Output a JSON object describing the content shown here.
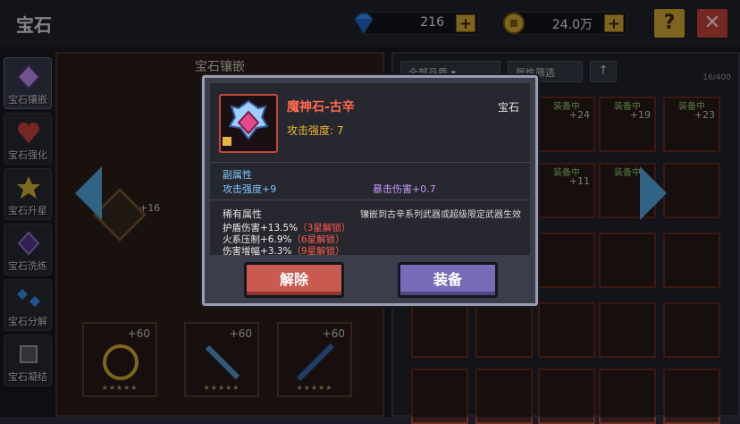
{
  "page": {
    "title": "宝石"
  },
  "currency": {
    "diamond": {
      "value": "216"
    },
    "gold": {
      "value": "24.0万"
    }
  },
  "top_buttons": {
    "help": "?",
    "close": "✕"
  },
  "sidebar": {
    "items": [
      {
        "label": "宝石镶嵌",
        "icon": "gem-inlay-icon"
      },
      {
        "label": "宝石强化",
        "icon": "gem-enhance-icon"
      },
      {
        "label": "宝石升星",
        "icon": "gem-star-icon"
      },
      {
        "label": "宝石洗练",
        "icon": "gem-refine-icon"
      },
      {
        "label": "宝石分解",
        "icon": "gem-decompose-icon"
      },
      {
        "label": "宝石凝结",
        "icon": "gem-condense-icon"
      }
    ]
  },
  "left_panel": {
    "title": "宝石镶嵌",
    "side_level": "+16",
    "bottom_slots": [
      {
        "level": "+60",
        "stars": "★★★★★"
      },
      {
        "level": "+60",
        "stars": "★★★★★"
      },
      {
        "level": "+60",
        "stars": "★★★★★"
      }
    ]
  },
  "right_panel": {
    "filter_quality": "全部品质",
    "filter_attr": "属性筛选",
    "count": "16/400",
    "equipped_tag": "装备中",
    "slot_levels": [
      "+24",
      "+19",
      "+23",
      "+11"
    ]
  },
  "modal": {
    "item_name": "魔神石-古辛",
    "item_type": "宝石",
    "attack": "攻击强度: 7",
    "sub_title": "副属性",
    "sub_stats": [
      "攻击强度+9",
      "暴击伤害+0.7"
    ],
    "rare_title": "稀有属性",
    "rare_note": "镶嵌到古辛系列武器或超级限定武器生效",
    "rare_stats": [
      {
        "text": "护盾伤害+13.5%",
        "lock": "（3星解锁）"
      },
      {
        "text": "火系压制+6.9%",
        "lock": "（6星解锁）"
      },
      {
        "text": "伤害增幅+3.3%",
        "lock": "（9星解锁）"
      }
    ],
    "btn_remove": "解除",
    "btn_equip": "装备"
  },
  "colors": {
    "accent_gold": "#e6b83a",
    "name_red": "#ff6a50",
    "stat_blue": "#7ec8ff",
    "stat_purple": "#c89cff",
    "remove_red": "#c85a52",
    "equip_purple": "#7a6bb8"
  }
}
